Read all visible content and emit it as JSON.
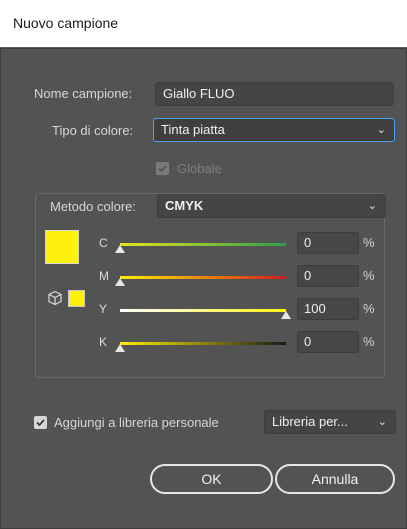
{
  "window": {
    "title": "Nuovo campione"
  },
  "name_field": {
    "label": "Nome campione:",
    "value": "Giallo FLUO"
  },
  "color_type": {
    "label": "Tipo di colore:",
    "value": "Tinta piatta"
  },
  "global": {
    "label": "Globale",
    "checked": true,
    "enabled": false
  },
  "color_mode": {
    "label": "Metodo colore:",
    "value": "CMYK"
  },
  "swatch": {
    "color": "#fff10e"
  },
  "channels": [
    {
      "name": "C",
      "value": "0",
      "unit": "%",
      "fraction": 0.0,
      "gradient": [
        "#e5e51a",
        "#2e9e4e"
      ]
    },
    {
      "name": "M",
      "value": "0",
      "unit": "%",
      "fraction": 0.0,
      "gradient": [
        "#ffee00",
        "#d21f1f"
      ]
    },
    {
      "name": "Y",
      "value": "100",
      "unit": "%",
      "fraction": 1.0,
      "gradient": [
        "#ffffff",
        "#fff10e"
      ]
    },
    {
      "name": "K",
      "value": "0",
      "unit": "%",
      "fraction": 0.0,
      "gradient": [
        "#ffee00",
        "#1a1a1a"
      ]
    }
  ],
  "library": {
    "checkbox_label": "Aggiungi a libreria personale",
    "checked": true,
    "select_value": "Libreria per..."
  },
  "buttons": {
    "ok": "OK",
    "cancel": "Annulla"
  },
  "colors": {
    "dialog_bg": "#535353",
    "focus_border": "#4aa0ff",
    "accent_yellow": "#fff10e"
  }
}
